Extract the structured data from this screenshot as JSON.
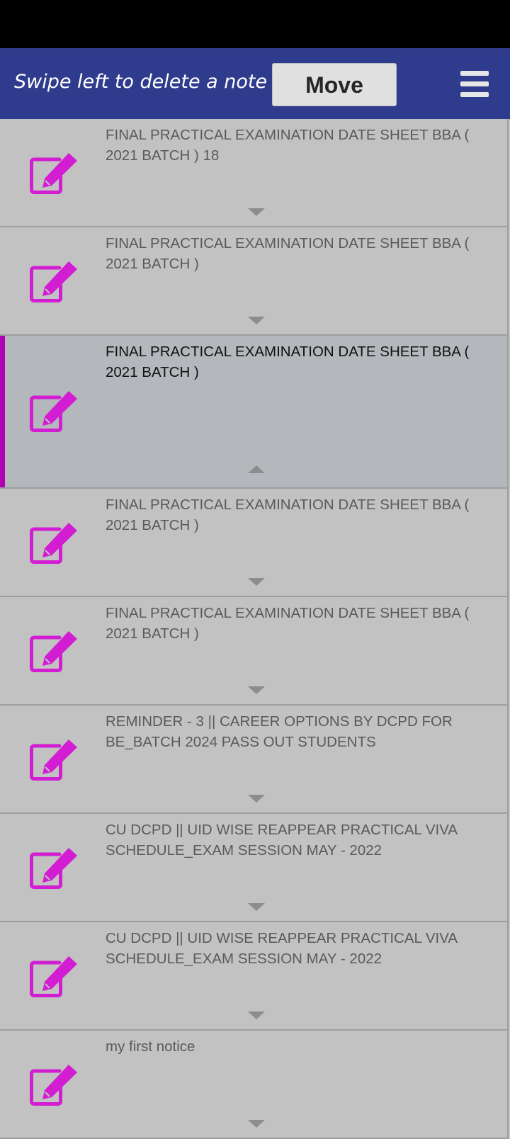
{
  "header": {
    "hint": "Swipe left to delete a note",
    "move_label": "Move",
    "menu_icon": "hamburger-menu-icon"
  },
  "colors": {
    "appbar": "#2f3b8c",
    "accent": "#b000b0",
    "icon": "#d21dd2",
    "list_bg": "#c2c2c2",
    "expanded_bg": "#b4b7bb"
  },
  "notes": [
    {
      "title": "FINAL PRACTICAL EXAMINATION DATE SHEET BBA ( 2021 BATCH ) 18",
      "icon": "edit-note-icon",
      "expanded": false
    },
    {
      "title": "FINAL PRACTICAL EXAMINATION DATE SHEET BBA ( 2021 BATCH )",
      "icon": "edit-note-icon",
      "expanded": false
    },
    {
      "title": "FINAL PRACTICAL EXAMINATION DATE SHEET BBA ( 2021 BATCH )",
      "icon": "edit-note-icon",
      "expanded": true
    },
    {
      "title": "FINAL PRACTICAL EXAMINATION DATE SHEET BBA ( 2021 BATCH )",
      "icon": "edit-note-icon",
      "expanded": false
    },
    {
      "title": "FINAL PRACTICAL EXAMINATION DATE SHEET BBA ( 2021 BATCH )",
      "icon": "edit-note-icon",
      "expanded": false
    },
    {
      "title": "REMINDER - 3 || CAREER OPTIONS BY DCPD FOR BE_BATCH 2024 PASS OUT STUDENTS",
      "icon": "edit-note-icon",
      "expanded": false
    },
    {
      "title": "CU DCPD || UID WISE REAPPEAR PRACTICAL VIVA SCHEDULE_EXAM SESSION MAY - 2022",
      "icon": "edit-note-icon",
      "expanded": false
    },
    {
      "title": "CU DCPD || UID WISE REAPPEAR PRACTICAL VIVA SCHEDULE_EXAM SESSION MAY - 2022",
      "icon": "edit-note-icon",
      "expanded": false
    },
    {
      "title": "my first notice",
      "icon": "edit-note-icon",
      "expanded": false
    }
  ]
}
